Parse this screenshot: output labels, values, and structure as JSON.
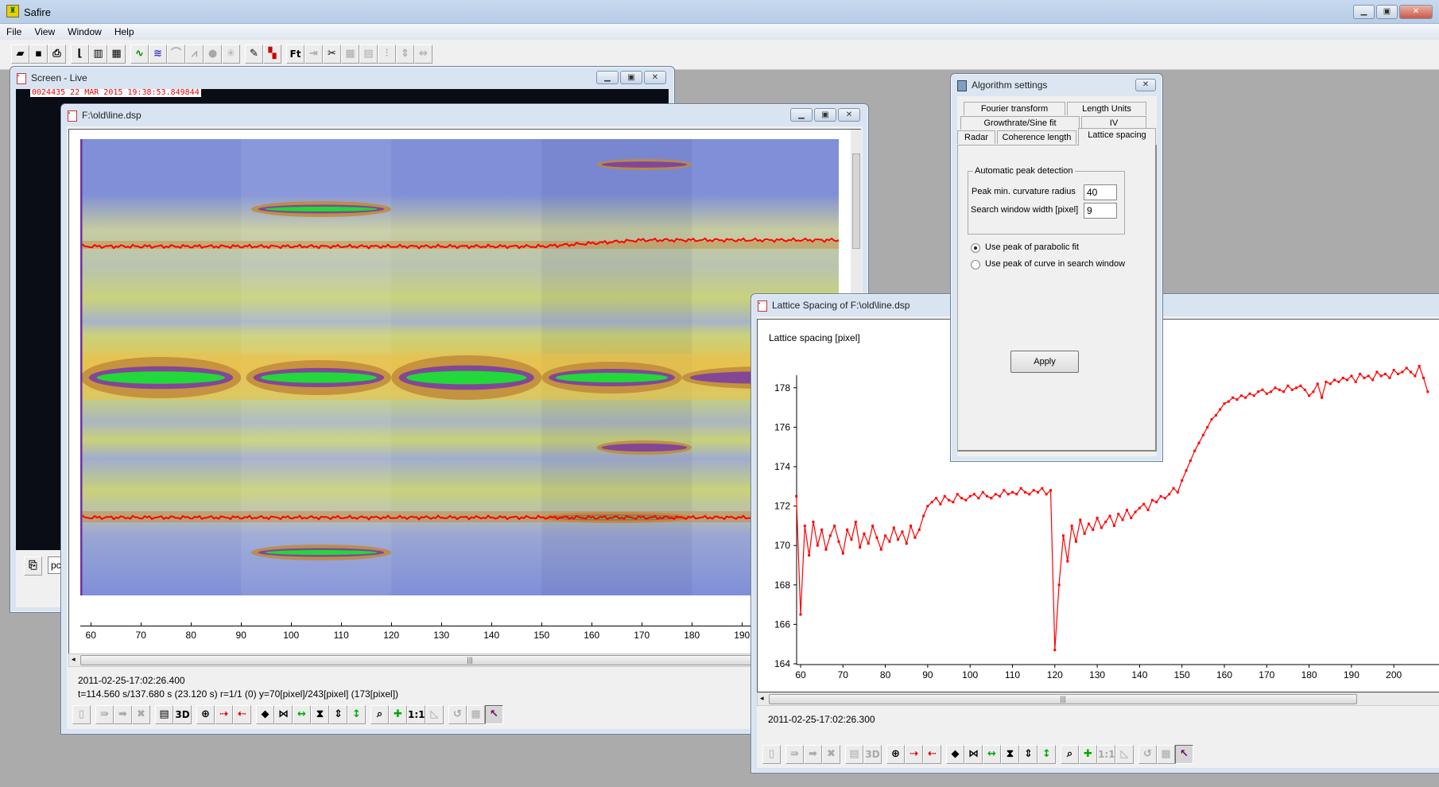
{
  "app": {
    "title": "Safire",
    "window_controls": [
      "minimize-icon",
      "restore-icon",
      "close-icon"
    ]
  },
  "menu": [
    "File",
    "View",
    "Window",
    "Help"
  ],
  "main_toolbar": [
    [
      {
        "icon": "open-folder",
        "enabled": true
      },
      {
        "icon": "save",
        "enabled": true
      },
      {
        "icon": "print",
        "enabled": true
      }
    ],
    [
      {
        "icon": "chart-axes",
        "enabled": true
      },
      {
        "icon": "bar-grid",
        "enabled": true
      },
      {
        "icon": "matrix",
        "enabled": true
      }
    ],
    [
      {
        "icon": "wave-green",
        "enabled": true
      },
      {
        "icon": "wave-blue",
        "enabled": true
      },
      {
        "icon": "fit",
        "enabled": false
      },
      {
        "icon": "peaks",
        "enabled": false
      },
      {
        "icon": "circle",
        "enabled": false
      },
      {
        "icon": "spectrum",
        "enabled": false
      }
    ],
    [
      {
        "icon": "wand",
        "enabled": true
      },
      {
        "icon": "color-palette",
        "enabled": true
      }
    ],
    [
      {
        "icon": "fourier-transform",
        "label": "Ft",
        "enabled": true
      },
      {
        "icon": "f-arrow",
        "enabled": false
      },
      {
        "icon": "scissors",
        "enabled": true
      },
      {
        "icon": "grid",
        "enabled": false
      },
      {
        "icon": "grid-split",
        "enabled": false
      },
      {
        "icon": "split-vertical",
        "enabled": false
      },
      {
        "icon": "split-vertical-2",
        "enabled": false
      },
      {
        "icon": "split-horizontal",
        "enabled": false
      }
    ]
  ],
  "screen_live": {
    "title": "Screen - Live",
    "timestamp": "0024435  22 MAR 2015  19:38:53.849844",
    "input_value": "pc"
  },
  "line_window": {
    "title": "F:\\old\\line.dsp",
    "x_ticks": [
      "60",
      "70",
      "80",
      "90",
      "100",
      "110",
      "120",
      "130",
      "140",
      "150",
      "160",
      "170",
      "180",
      "190"
    ],
    "colormap": [
      "#7f8fd8",
      "#c9d27a",
      "#e8c24e",
      "#c08a3a",
      "#7b3fa0",
      "#22d83a"
    ],
    "status_date": "2011-02-25-17:02:26.400",
    "status_info": "t=114.560 s/137.680 s (23.120 s) r=1/1 (0) y=70[pixel]/243[pixel] (173[pixel])",
    "toolbar": [
      [
        {
          "icon": "trash",
          "enabled": false
        }
      ],
      [
        {
          "icon": "arrow-pass",
          "enabled": false
        },
        {
          "icon": "arrow-right",
          "enabled": false
        },
        {
          "icon": "arrows-merge",
          "enabled": false
        }
      ],
      [
        {
          "icon": "bars",
          "enabled": true
        },
        {
          "icon": "3d-view",
          "label": "3D",
          "enabled": true
        }
      ],
      [
        {
          "icon": "crosshair",
          "enabled": true
        },
        {
          "icon": "marker-right",
          "enabled": true
        },
        {
          "icon": "marker-left",
          "enabled": true
        }
      ],
      [
        {
          "icon": "diamond",
          "enabled": true
        },
        {
          "icon": "bowtie-horizontal",
          "enabled": true
        },
        {
          "icon": "stretch-horizontal",
          "enabled": true
        },
        {
          "icon": "hourglass",
          "enabled": true
        },
        {
          "icon": "arrows-vertical",
          "enabled": true
        },
        {
          "icon": "stretch-vertical",
          "enabled": true
        }
      ],
      [
        {
          "icon": "zoom",
          "enabled": true
        },
        {
          "icon": "fit-all",
          "enabled": true
        },
        {
          "icon": "one-to-one",
          "label": "1:1",
          "enabled": true
        },
        {
          "icon": "page",
          "enabled": false
        }
      ],
      [
        {
          "icon": "undo",
          "enabled": false
        },
        {
          "icon": "grid",
          "enabled": false
        },
        {
          "icon": "select-tool",
          "enabled": true,
          "active": true
        }
      ]
    ]
  },
  "algorithm_settings": {
    "title": "Algorithm settings",
    "tabs_row1": [
      "Fourier transform",
      "Length Units"
    ],
    "tabs_row2": [
      "Growthrate/Sine fit",
      "IV"
    ],
    "tabs_row3": [
      "Radar",
      "Coherence length",
      "Lattice spacing"
    ],
    "active_tab": "Lattice spacing",
    "group_title": "Automatic peak detection",
    "peak_radius_label": "Peak min. curvature radius",
    "peak_radius_value": "40",
    "search_width_label": "Search window width [pixel]",
    "search_width_value": "9",
    "radio_parabolic": "Use peak of parabolic fit",
    "radio_curve": "Use peak of curve in search window",
    "selected_radio": "parabolic",
    "apply_label": "Apply"
  },
  "lattice_window": {
    "title": "Lattice Spacing of F:\\old\\line.dsp",
    "status_date": "2011-02-25-17:02:26.300",
    "toolbar": [
      [
        {
          "icon": "trash",
          "enabled": false
        }
      ],
      [
        {
          "icon": "arrow-pass",
          "enabled": false
        },
        {
          "icon": "arrow-right",
          "enabled": false
        },
        {
          "icon": "arrows-merge",
          "enabled": false
        }
      ],
      [
        {
          "icon": "bars",
          "enabled": false
        },
        {
          "icon": "3d-view",
          "label": "3D",
          "enabled": false
        }
      ],
      [
        {
          "icon": "crosshair",
          "enabled": true
        },
        {
          "icon": "marker-right",
          "enabled": true
        },
        {
          "icon": "marker-left",
          "enabled": true
        }
      ],
      [
        {
          "icon": "diamond",
          "enabled": true
        },
        {
          "icon": "bowtie-horizontal",
          "enabled": true
        },
        {
          "icon": "stretch-horizontal",
          "enabled": true
        },
        {
          "icon": "hourglass",
          "enabled": true
        },
        {
          "icon": "arrows-vertical",
          "enabled": true
        },
        {
          "icon": "stretch-vertical",
          "enabled": true
        }
      ],
      [
        {
          "icon": "zoom",
          "enabled": true
        },
        {
          "icon": "fit-all",
          "enabled": true
        },
        {
          "icon": "one-to-one",
          "label": "1:1",
          "enabled": false
        },
        {
          "icon": "page",
          "enabled": false
        }
      ],
      [
        {
          "icon": "undo",
          "enabled": false
        },
        {
          "icon": "grid",
          "enabled": false
        },
        {
          "icon": "select-tool",
          "enabled": true,
          "active": true
        }
      ]
    ]
  },
  "chart_data": {
    "type": "line",
    "title": "",
    "ylabel": "Lattice spacing [pixel]",
    "xlabel": "",
    "x_ticks": [
      60,
      70,
      80,
      90,
      100,
      110,
      120,
      130,
      140,
      150,
      160,
      170,
      180,
      190,
      200
    ],
    "y_ticks": [
      164,
      166,
      168,
      170,
      172,
      174,
      176,
      178
    ],
    "xlim": [
      57.3,
      210
    ],
    "ylim": [
      164,
      180
    ],
    "grid": false,
    "series_color": "#ff0000",
    "points": [
      [
        59,
        172.5
      ],
      [
        60,
        166.5
      ],
      [
        61,
        171
      ],
      [
        62,
        169.5
      ],
      [
        63,
        171.2
      ],
      [
        64,
        170
      ],
      [
        65,
        170.8
      ],
      [
        66,
        169.8
      ],
      [
        67,
        170.5
      ],
      [
        68,
        171
      ],
      [
        69,
        170.2
      ],
      [
        70,
        169.6
      ],
      [
        71,
        170.8
      ],
      [
        72,
        170.3
      ],
      [
        73,
        171.2
      ],
      [
        74,
        169.9
      ],
      [
        75,
        170.6
      ],
      [
        76,
        170.1
      ],
      [
        77,
        171
      ],
      [
        78,
        170.4
      ],
      [
        79,
        169.8
      ],
      [
        80,
        170.5
      ],
      [
        81,
        170.2
      ],
      [
        82,
        170.9
      ],
      [
        83,
        170.3
      ],
      [
        84,
        170.7
      ],
      [
        85,
        170.1
      ],
      [
        86,
        171
      ],
      [
        87,
        170.4
      ],
      [
        88,
        170.8
      ],
      [
        89,
        171.5
      ],
      [
        90,
        172
      ],
      [
        91,
        172.2
      ],
      [
        92,
        172.4
      ],
      [
        93,
        172.1
      ],
      [
        94,
        172.5
      ],
      [
        95,
        172.3
      ],
      [
        96,
        172.2
      ],
      [
        97,
        172.6
      ],
      [
        98,
        172.4
      ],
      [
        99,
        172.3
      ],
      [
        100,
        172.5
      ],
      [
        101,
        172.6
      ],
      [
        102,
        172.4
      ],
      [
        103,
        172.7
      ],
      [
        104,
        172.5
      ],
      [
        105,
        172.4
      ],
      [
        106,
        172.6
      ],
      [
        107,
        172.5
      ],
      [
        108,
        172.8
      ],
      [
        109,
        172.6
      ],
      [
        110,
        172.7
      ],
      [
        111,
        172.6
      ],
      [
        112,
        172.9
      ],
      [
        113,
        172.7
      ],
      [
        114,
        172.6
      ],
      [
        115,
        172.8
      ],
      [
        116,
        172.7
      ],
      [
        117,
        172.9
      ],
      [
        118,
        172.6
      ],
      [
        119,
        172.8
      ],
      [
        120,
        164.7
      ],
      [
        121,
        168
      ],
      [
        122,
        170.5
      ],
      [
        123,
        169.2
      ],
      [
        124,
        171
      ],
      [
        125,
        170.2
      ],
      [
        126,
        171.3
      ],
      [
        127,
        170.6
      ],
      [
        128,
        171.1
      ],
      [
        129,
        170.8
      ],
      [
        130,
        171.4
      ],
      [
        131,
        170.9
      ],
      [
        132,
        171.2
      ],
      [
        133,
        171.5
      ],
      [
        134,
        171
      ],
      [
        135,
        171.6
      ],
      [
        136,
        171.3
      ],
      [
        137,
        171.8
      ],
      [
        138,
        171.4
      ],
      [
        139,
        171.7
      ],
      [
        140,
        171.9
      ],
      [
        141,
        172.1
      ],
      [
        142,
        171.8
      ],
      [
        143,
        172.3
      ],
      [
        144,
        172.2
      ],
      [
        145,
        172.5
      ],
      [
        146,
        172.4
      ],
      [
        147,
        172.6
      ],
      [
        148,
        172.9
      ],
      [
        149,
        172.7
      ],
      [
        150,
        173.3
      ],
      [
        151,
        173.8
      ],
      [
        152,
        174.3
      ],
      [
        153,
        174.8
      ],
      [
        154,
        175.2
      ],
      [
        155,
        175.6
      ],
      [
        156,
        176
      ],
      [
        157,
        176.4
      ],
      [
        158,
        176.6
      ],
      [
        159,
        176.9
      ],
      [
        160,
        177.2
      ],
      [
        161,
        177.3
      ],
      [
        162,
        177.5
      ],
      [
        163,
        177.4
      ],
      [
        164,
        177.6
      ],
      [
        165,
        177.5
      ],
      [
        166,
        177.7
      ],
      [
        167,
        177.6
      ],
      [
        168,
        177.8
      ],
      [
        169,
        177.9
      ],
      [
        170,
        177.7
      ],
      [
        171,
        177.8
      ],
      [
        172,
        178
      ],
      [
        173,
        177.9
      ],
      [
        174,
        177.8
      ],
      [
        175,
        178.1
      ],
      [
        176,
        177.9
      ],
      [
        177,
        178
      ],
      [
        178,
        178.1
      ],
      [
        179,
        177.9
      ],
      [
        180,
        177.6
      ],
      [
        181,
        177.8
      ],
      [
        182,
        178.2
      ],
      [
        183,
        177.5
      ],
      [
        184,
        178.3
      ],
      [
        185,
        178.2
      ],
      [
        186,
        178.4
      ],
      [
        187,
        178.3
      ],
      [
        188,
        178.5
      ],
      [
        189,
        178.4
      ],
      [
        190,
        178.6
      ],
      [
        191,
        178.3
      ],
      [
        192,
        178.7
      ],
      [
        193,
        178.5
      ],
      [
        194,
        178.6
      ],
      [
        195,
        178.4
      ],
      [
        196,
        178.8
      ],
      [
        197,
        178.6
      ],
      [
        198,
        178.7
      ],
      [
        199,
        178.5
      ],
      [
        200,
        178.9
      ],
      [
        201,
        178.7
      ],
      [
        202,
        178.8
      ],
      [
        203,
        179
      ],
      [
        204,
        178.8
      ],
      [
        205,
        178.6
      ],
      [
        206,
        179.1
      ],
      [
        207,
        178.5
      ],
      [
        208,
        177.8
      ]
    ]
  }
}
